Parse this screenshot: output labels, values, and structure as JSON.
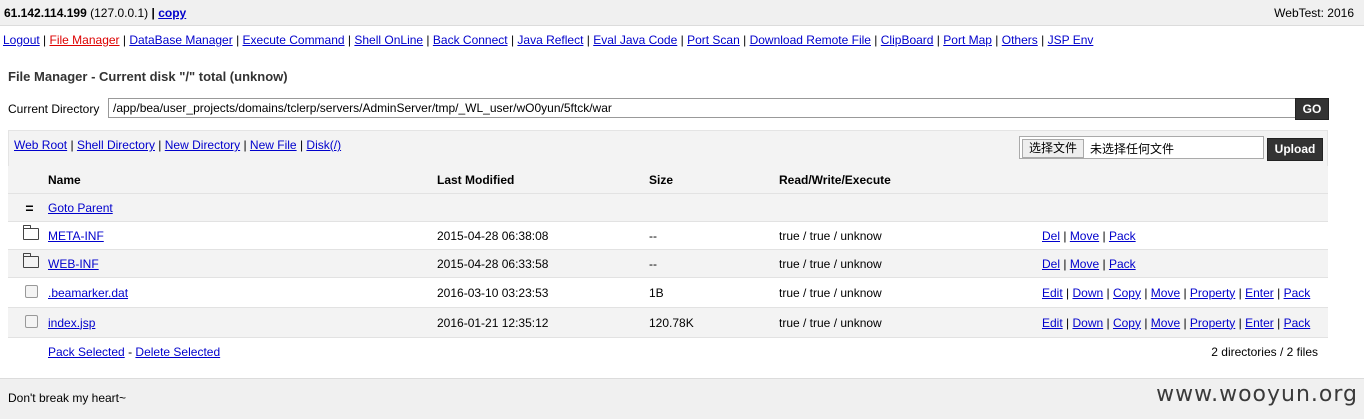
{
  "header": {
    "ip": "61.142.114.199",
    "local": "(127.0.0.1)",
    "copy": "copy",
    "title": "WebTest: 2016"
  },
  "nav": [
    {
      "label": "Logout",
      "active": false
    },
    {
      "label": "File Manager",
      "active": true
    },
    {
      "label": "DataBase Manager",
      "active": false
    },
    {
      "label": "Execute Command",
      "active": false
    },
    {
      "label": "Shell OnLine",
      "active": false
    },
    {
      "label": "Back Connect",
      "active": false
    },
    {
      "label": "Java Reflect",
      "active": false
    },
    {
      "label": "Eval Java Code",
      "active": false
    },
    {
      "label": "Port Scan",
      "active": false
    },
    {
      "label": "Download Remote File",
      "active": false
    },
    {
      "label": "ClipBoard",
      "active": false
    },
    {
      "label": "Port Map",
      "active": false
    },
    {
      "label": "Others",
      "active": false
    },
    {
      "label": "JSP Env",
      "active": false
    }
  ],
  "main": {
    "title": "File Manager - Current disk \"/\" total (unknow)",
    "dir_label": "Current Directory",
    "dir_value": "/app/bea/user_projects/domains/tclerp/servers/AdminServer/tmp/_WL_user/wO0yun/5ftck/war",
    "go": "GO"
  },
  "quick_links": [
    "Web Root",
    "Shell Directory",
    "New Directory",
    "New File",
    "Disk(/)"
  ],
  "upload": {
    "choose": "选择文件",
    "no_file": "未选择任何文件",
    "button": "Upload"
  },
  "table": {
    "headers": [
      "Name",
      "Last Modified",
      "Size",
      "Read/Write/Execute"
    ],
    "parent_label": "Goto Parent",
    "parent_icon": "=",
    "rows": [
      {
        "type": "folder",
        "name": "META-INF",
        "modified": "2015-04-28 06:38:08",
        "size": "--",
        "perm": "true / true / unknow",
        "actions": [
          "Del",
          "Move",
          "Pack"
        ]
      },
      {
        "type": "folder",
        "name": "WEB-INF",
        "modified": "2015-04-28 06:33:58",
        "size": "--",
        "perm": "true / true / unknow",
        "actions": [
          "Del",
          "Move",
          "Pack"
        ]
      },
      {
        "type": "file",
        "name": ".beamarker.dat",
        "modified": "2016-03-10 03:23:53",
        "size": "1B",
        "perm": "true / true / unknow",
        "actions": [
          "Edit",
          "Down",
          "Copy",
          "Move",
          "Property",
          "Enter",
          "Pack"
        ]
      },
      {
        "type": "file",
        "name": "index.jsp",
        "modified": "2016-01-21 12:35:12",
        "size": "120.78K",
        "perm": "true / true / unknow",
        "actions": [
          "Edit",
          "Down",
          "Copy",
          "Move",
          "Property",
          "Enter",
          "Pack"
        ]
      }
    ],
    "footer": {
      "pack_selected": "Pack Selected",
      "sep": "-",
      "delete_selected": "Delete Selected",
      "summary": "2 directories / 2 files"
    }
  },
  "footer": {
    "text": "Don't break my heart~",
    "watermark": "www.wooyun.org"
  },
  "colors": {
    "link": "#0000cc",
    "active_link": "#dd0000",
    "button_bg": "#333333",
    "panel_bg": "#f3f3f3"
  }
}
